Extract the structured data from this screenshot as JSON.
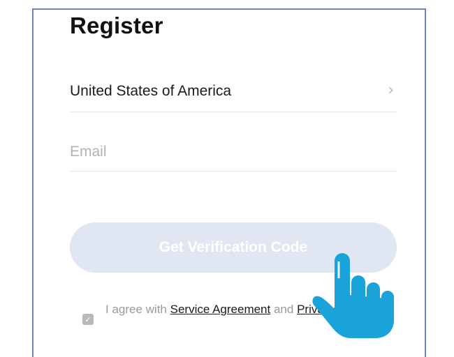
{
  "header": {
    "title": "Register"
  },
  "form": {
    "country": {
      "value": "United States of America",
      "chevron_icon": "chevron-right-icon"
    },
    "email": {
      "value": "",
      "placeholder": "Email"
    },
    "verify_button_label": "Get Verification Code"
  },
  "agreement": {
    "checked": true,
    "prefix": "I agree with ",
    "service_link": "Service Agreement",
    "joiner": " and ",
    "privacy_link": "Privacy Policy"
  },
  "overlay": {
    "icon": "pointing-hand-icon",
    "color": "#1aa3d9"
  },
  "colors": {
    "frame_border": "#6f83b8",
    "button_disabled": "#e1e6f3"
  }
}
